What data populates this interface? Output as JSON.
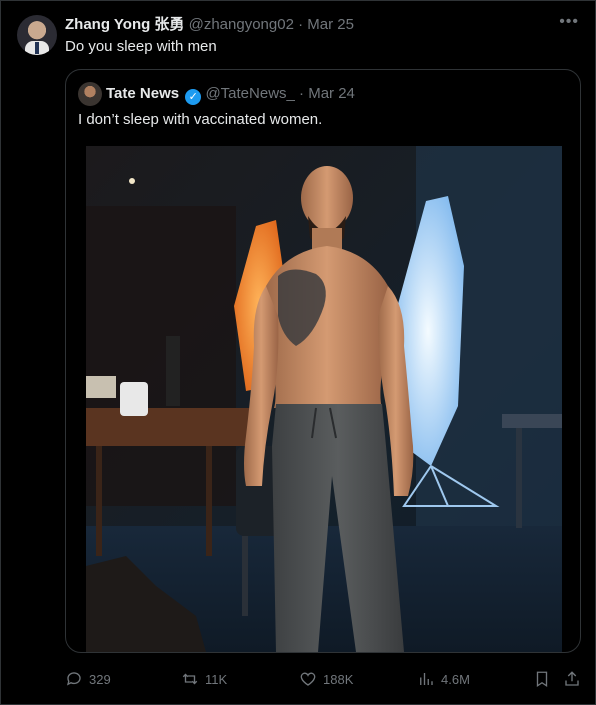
{
  "tweet": {
    "display_name": "Zhang Yong 张勇",
    "handle": "@zhangyong02",
    "separator": "·",
    "date": "Mar 25",
    "more_label": "•••",
    "text": "Do you sleep with men"
  },
  "quoted": {
    "display_name": "Tate News",
    "verified_mark": "✓",
    "handle": "@TateNews_",
    "separator": "·",
    "date": "Mar 24",
    "text": "I don’t sleep with vaccinated women."
  },
  "metrics": {
    "replies": "329",
    "reposts": "11K",
    "likes": "188K",
    "views": "4.6M"
  },
  "colors": {
    "background": "#000000",
    "text": "#e7e9ea",
    "muted": "#71767b",
    "border": "#2f3336",
    "verified": "#1d9bf0"
  },
  "icons": [
    "reply-icon",
    "repost-icon",
    "like-icon",
    "views-icon",
    "bookmark-icon",
    "share-icon",
    "verified-icon",
    "more-icon"
  ]
}
